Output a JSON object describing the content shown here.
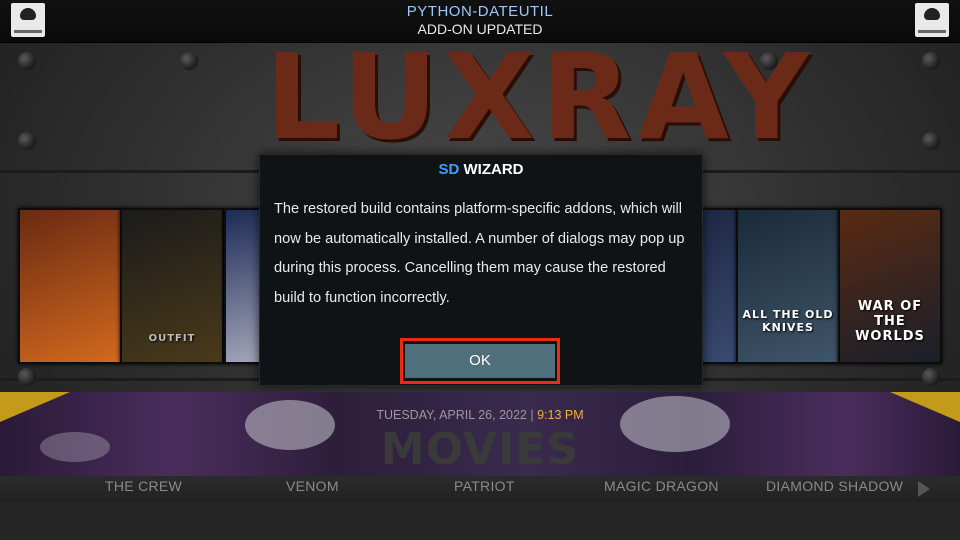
{
  "notification": {
    "title": "PYTHON-DATEUTIL",
    "subtitle": "ADD-ON UPDATED"
  },
  "logo_text": "LUXRAY",
  "posters": [
    {
      "caption": "",
      "colors": [
        "#6a2a12",
        "#d2691e"
      ]
    },
    {
      "caption": "OUTFIT",
      "colors": [
        "#1b1b1b",
        "#4a3a1a"
      ]
    },
    {
      "caption": "",
      "colors": [
        "#1b2a55",
        "#b9b9c9"
      ]
    },
    {
      "caption": "",
      "colors": [
        "#1a2440",
        "#3a4a70"
      ]
    },
    {
      "caption": "ALL THE OLD KNIVES",
      "colors": [
        "#1a2a3a",
        "#3f5568"
      ]
    },
    {
      "caption": "WAR OF THE WORLDS",
      "colors": [
        "#5a2a12",
        "#1a1f2a"
      ]
    }
  ],
  "dialog": {
    "title_accent": "SD",
    "title_rest": " WIZARD",
    "message": "The restored build contains platform-specific addons, which will now be automatically installed. A number of dialogs may pop up during this process. Cancelling them may cause the restored build to function incorrectly.",
    "ok_label": "OK"
  },
  "status": {
    "date": "TUESDAY, APRIL 26, 2022",
    "separator": " | ",
    "time": "9:13 PM"
  },
  "section_title": "MOVIES",
  "menu": [
    "THE CREW",
    "VENOM",
    "PATRIOT",
    "MAGIC DRAGON",
    "DIAMOND SHADOW"
  ],
  "colors": {
    "accent_blue": "#3aa0ff",
    "ok_button": "#506f7d",
    "highlight_frame": "#ee2a12",
    "time_color": "#f0b23a"
  }
}
